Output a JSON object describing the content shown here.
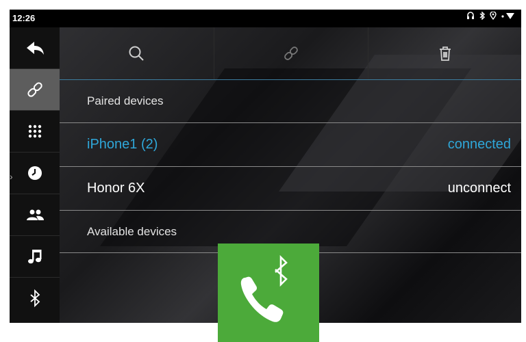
{
  "status_bar": {
    "time": "12:26",
    "icons": [
      "headphones-icon",
      "bluetooth-icon",
      "location-icon",
      "wifi-icon"
    ]
  },
  "sidebar": {
    "items": [
      {
        "name": "back",
        "icon": "back-arrow-icon"
      },
      {
        "name": "link",
        "icon": "link-icon",
        "active": true
      },
      {
        "name": "dialpad",
        "icon": "dialpad-icon"
      },
      {
        "name": "recent",
        "icon": "clock-icon"
      },
      {
        "name": "contacts",
        "icon": "contacts-icon"
      },
      {
        "name": "music",
        "icon": "music-note-icon"
      },
      {
        "name": "bluetooth",
        "icon": "bluetooth-icon"
      }
    ]
  },
  "toolbar": {
    "buttons": [
      "search-icon",
      "link-icon",
      "trash-icon"
    ]
  },
  "paired": {
    "label": "Paired devices",
    "devices": [
      {
        "name": "iPhone1 (2)",
        "status": "connected",
        "connected": true
      },
      {
        "name": "Honor 6X",
        "status": "unconnect",
        "connected": false
      }
    ]
  },
  "available": {
    "label": "Available devices"
  },
  "overlay": {
    "icon": "bluetooth-phone-app-icon",
    "color": "#4caa3a"
  },
  "colors": {
    "accent": "#2fa7d9",
    "active_sidebar": "#5d5d5d"
  }
}
